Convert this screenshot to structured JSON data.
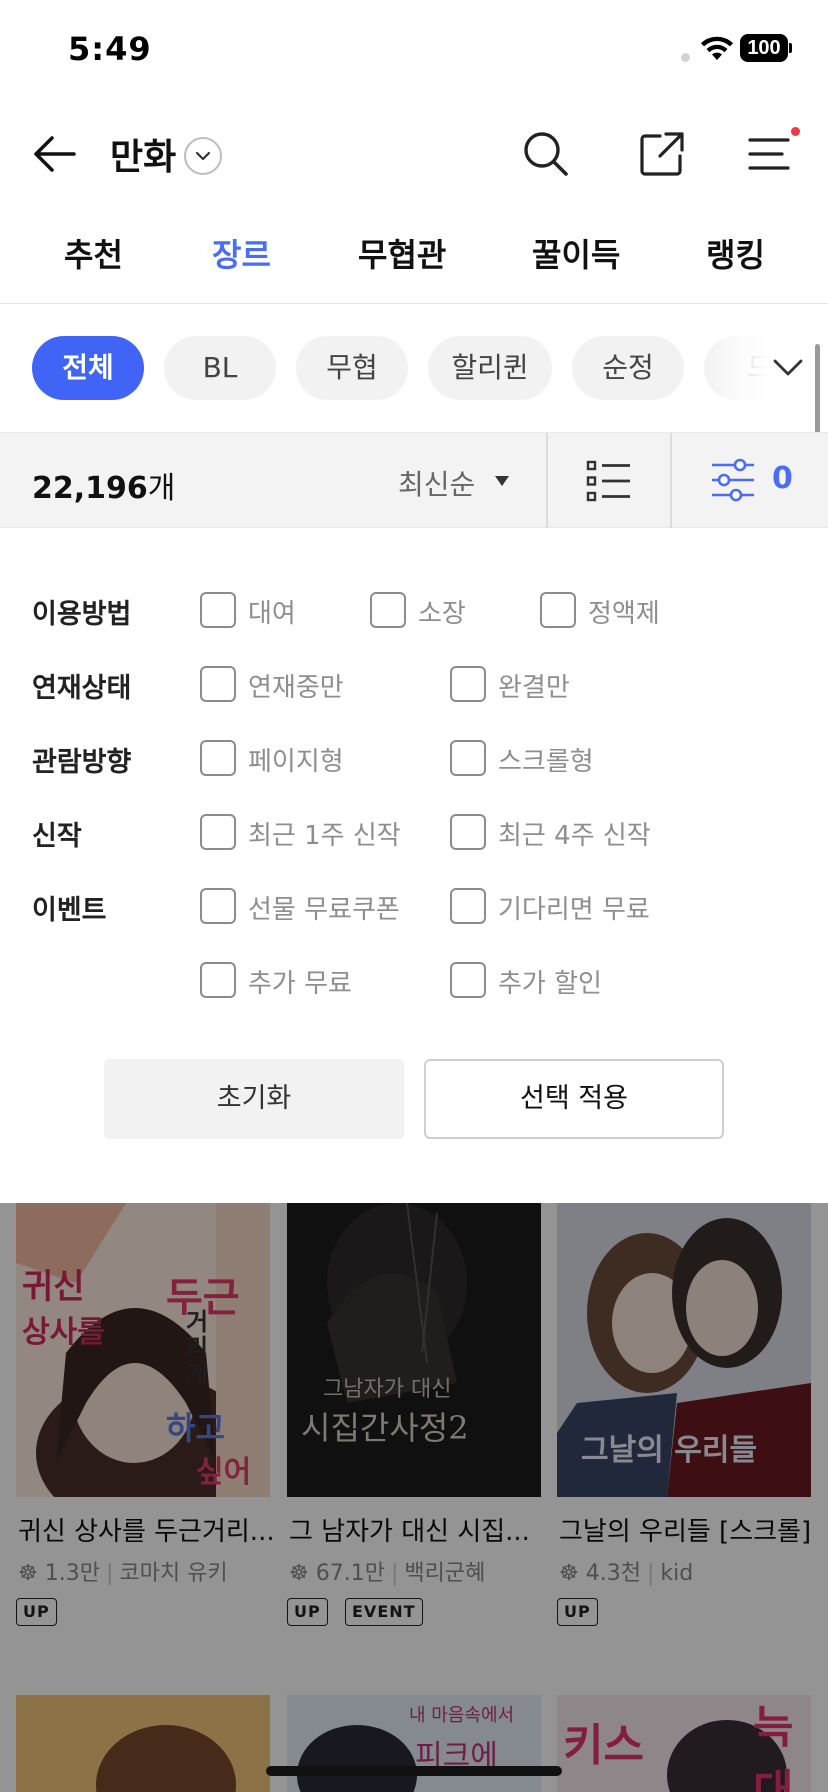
{
  "status": {
    "time": "5:49",
    "battery": "100"
  },
  "header": {
    "title": "만화"
  },
  "tabs": [
    {
      "label": "추천"
    },
    {
      "label": "장르"
    },
    {
      "label": "무협관"
    },
    {
      "label": "꿀이득"
    },
    {
      "label": "랭킹"
    }
  ],
  "genres": [
    {
      "label": "전체"
    },
    {
      "label": "BL"
    },
    {
      "label": "무협"
    },
    {
      "label": "할리퀸"
    },
    {
      "label": "순정"
    },
    {
      "label": "드"
    }
  ],
  "sortbar": {
    "count": "22,196",
    "count_unit": "개",
    "sort": "최신순",
    "filter_count": "0"
  },
  "filters": {
    "usage": {
      "label": "이용방법",
      "options": [
        "대여",
        "소장",
        "정액제"
      ]
    },
    "status": {
      "label": "연재상태",
      "options": [
        "연재중만",
        "완결만"
      ]
    },
    "view": {
      "label": "관람방향",
      "options": [
        "페이지형",
        "스크롤형"
      ]
    },
    "new": {
      "label": "신작",
      "options": [
        "최근 1주 신작",
        "최근 4주 신작"
      ]
    },
    "event": {
      "label": "이벤트",
      "options": [
        "선물 무료쿠폰",
        "기다리면 무료",
        "추가 무료",
        "추가 할인"
      ]
    }
  },
  "buttons": {
    "reset": "초기화",
    "apply": "선택 적용"
  },
  "cards": [
    {
      "title": "귀신 상사를 두근거리...",
      "views": "1.3만",
      "author": "코마치 유키",
      "tags": [
        "UP"
      ],
      "cover_text": [
        "귀신",
        "상사를",
        "두근",
        "거리게",
        "하고",
        "싶어"
      ]
    },
    {
      "title": "그 남자가 대신 시집...",
      "views": "67.1만",
      "author": "백리군혜",
      "tags": [
        "UP",
        "EVENT"
      ],
      "cover_text": [
        "그남자가 대신",
        "시집간사정2"
      ]
    },
    {
      "title": "그날의 우리들 [스크롤]",
      "views": "4.3천",
      "author": "kid",
      "tags": [
        "UP"
      ],
      "cover_text": [
        "그날의 우리들"
      ]
    }
  ],
  "row2_cover_text": [
    "내 마음속에서",
    "피크에",
    "키스",
    "늑대"
  ],
  "colors": {
    "accent": "#4a6cf7",
    "chip_active": "#4065f6",
    "badge": "#f0384c"
  }
}
